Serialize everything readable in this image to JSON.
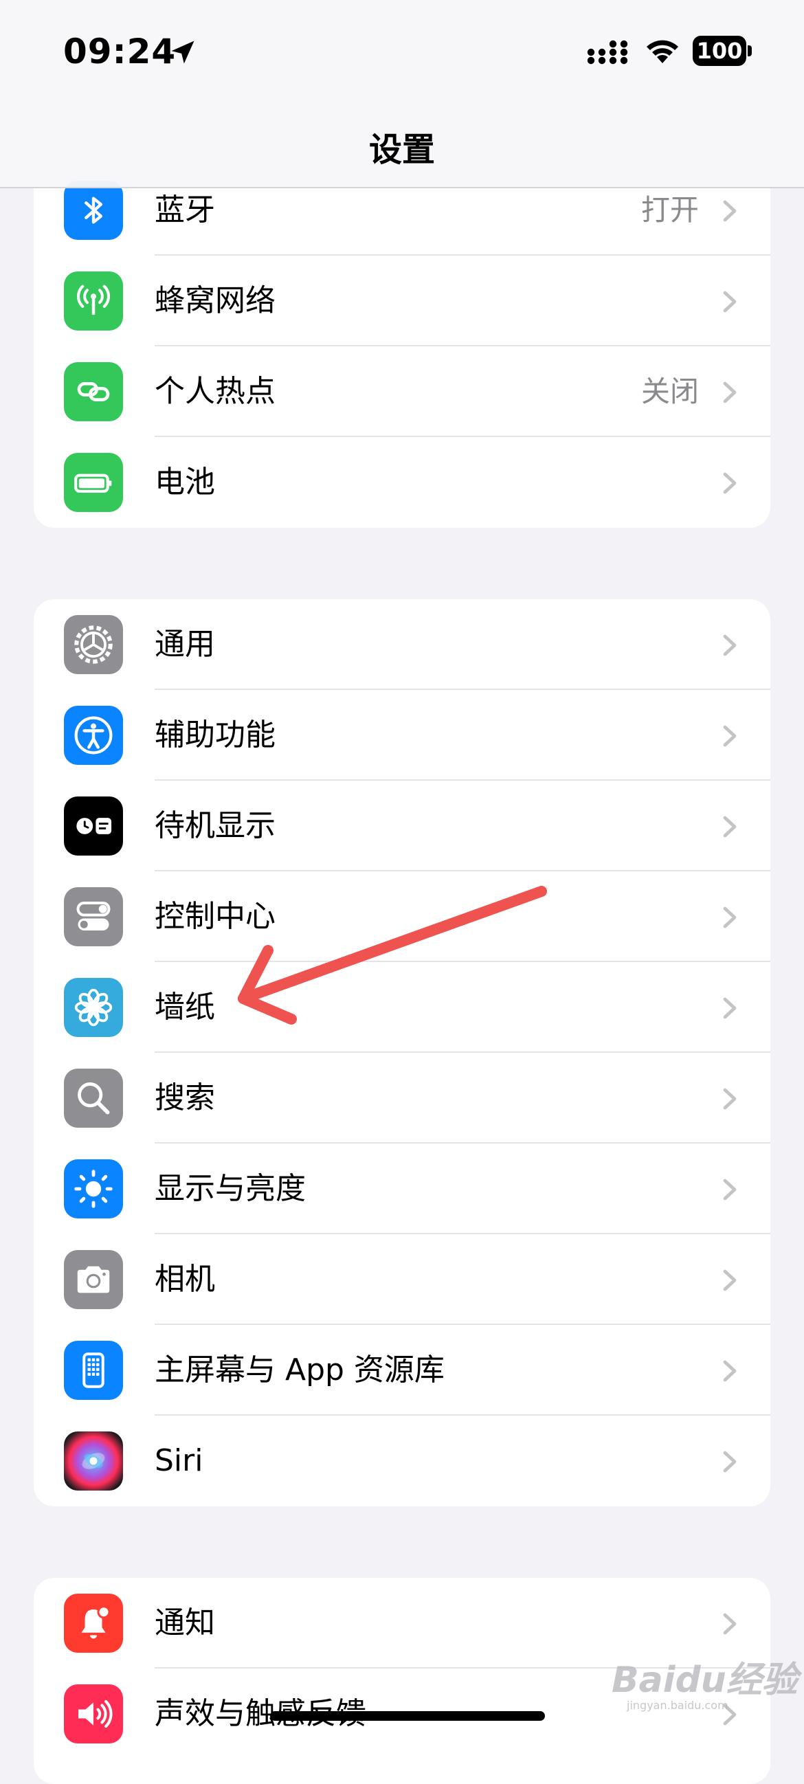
{
  "status": {
    "time": "09:24",
    "battery": "100"
  },
  "nav": {
    "title": "设置"
  },
  "groups": [
    {
      "items": [
        {
          "label": "蓝牙",
          "value": "打开",
          "icon": "bluetooth-icon",
          "color": "#0a84ff"
        },
        {
          "label": "蜂窝网络",
          "value": "",
          "icon": "cellular-antenna-icon",
          "color": "#34c759"
        },
        {
          "label": "个人热点",
          "value": "关闭",
          "icon": "hotspot-link-icon",
          "color": "#34c759"
        },
        {
          "label": "电池",
          "value": "",
          "icon": "battery-icon",
          "color": "#34c759"
        }
      ]
    },
    {
      "items": [
        {
          "label": "通用",
          "icon": "gear-icon",
          "color": "#8e8e93"
        },
        {
          "label": "辅助功能",
          "icon": "accessibility-icon",
          "color": "#0a84ff"
        },
        {
          "label": "待机显示",
          "icon": "standby-icon",
          "color": "#000000"
        },
        {
          "label": "控制中心",
          "icon": "toggles-icon",
          "color": "#8e8e93"
        },
        {
          "label": "墙纸",
          "icon": "flower-icon",
          "color": "#35aadc"
        },
        {
          "label": "搜索",
          "icon": "search-icon",
          "color": "#8e8e93"
        },
        {
          "label": "显示与亮度",
          "icon": "sun-icon",
          "color": "#0a84ff"
        },
        {
          "label": "相机",
          "icon": "camera-icon",
          "color": "#8e8e93"
        },
        {
          "label": "主屏幕与 App 资源库",
          "icon": "home-screen-icon",
          "color": "#0a84ff"
        },
        {
          "label": "Siri",
          "icon": "siri-icon",
          "color": "#1c1c1e"
        }
      ]
    },
    {
      "items": [
        {
          "label": "通知",
          "icon": "notification-bell-icon",
          "color": "#ff3b30"
        },
        {
          "label": "声效与触感反馈",
          "icon": "speaker-icon",
          "color": "#ff2d55"
        }
      ]
    }
  ],
  "annotation": {
    "color": "#ef5350",
    "points_to": "墙纸"
  },
  "watermark": {
    "brand": "Baidu经验",
    "site": "jingyan.baidu.com"
  }
}
